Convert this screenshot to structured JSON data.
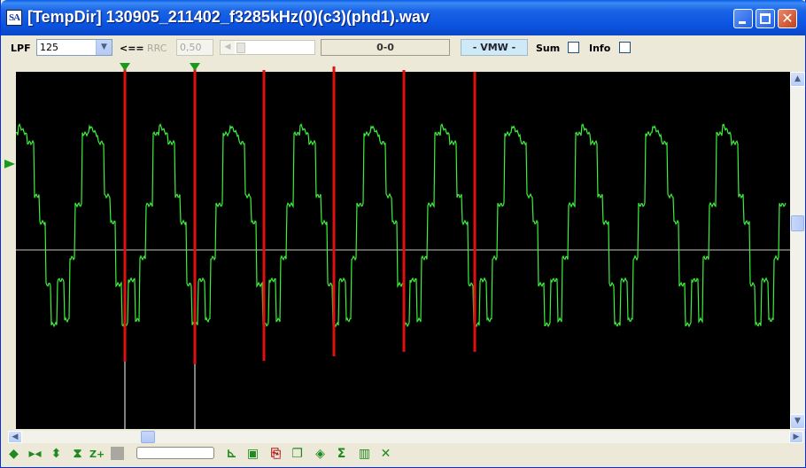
{
  "window": {
    "title": "[TempDir] 130905_211402_f3285kHz(0)(c3)(phd1).wav",
    "app_icon_text": "SA",
    "controls": [
      "minimize-icon",
      "maximize-icon",
      "close-icon"
    ],
    "close_glyph": "✕"
  },
  "toolbar": {
    "lpf_label": "LPF",
    "lpf_value": "125",
    "arrow_label": "<==",
    "rrc_label": "RRC",
    "rrc_value": "0,50",
    "readout": "0-0",
    "mode": "- VMW -",
    "sum_label": "Sum",
    "sum_checked": false,
    "info_label": "Info",
    "info_checked": false
  },
  "scope": {
    "background": "#000000",
    "trace_color": "#3cf03c",
    "marker_color": "#e01010",
    "cursor_color": "#ffffff"
  },
  "bottom_toolbar": {
    "icons": [
      "pan-horizontal-icon",
      "zoom-in-horizontal-icon",
      "pan-vertical-icon",
      "zoom-in-vertical-icon",
      "zoom-plus-icon",
      "stop-square-icon",
      "progress-bar",
      "step-icon",
      "step-alt-icon",
      "clipboard-copy-icon",
      "copy-icon",
      "diamond-icon",
      "sigma-icon",
      "bars-icon",
      "cross-arrows-icon"
    ],
    "zoom_plus_text": "Z+"
  }
}
